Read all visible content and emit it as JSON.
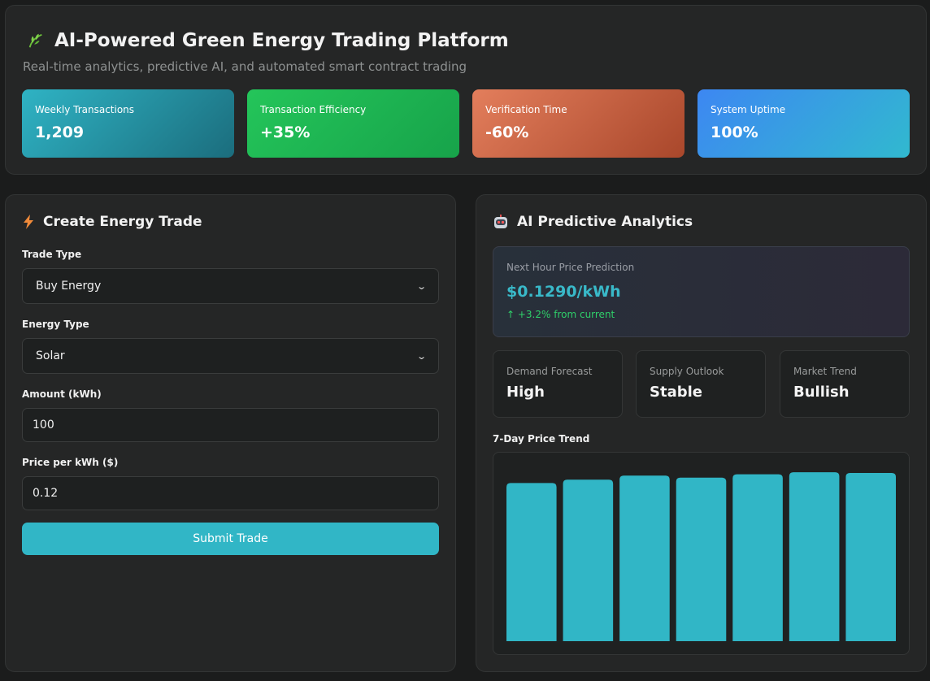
{
  "header": {
    "icon": "leaf-icon",
    "title": "AI-Powered Green Energy Trading Platform",
    "subtitle": "Real-time analytics, predictive AI, and automated smart contract trading",
    "stats": [
      {
        "label": "Weekly Transactions",
        "value": "1,209"
      },
      {
        "label": "Transaction Efficiency",
        "value": "+35%"
      },
      {
        "label": "Verification Time",
        "value": "-60%"
      },
      {
        "label": "System Uptime",
        "value": "100%"
      }
    ]
  },
  "trade_form": {
    "icon": "lightning-icon",
    "title": "Create Energy Trade",
    "trade_type_label": "Trade Type",
    "trade_type_value": "Buy Energy",
    "energy_type_label": "Energy Type",
    "energy_type_value": "Solar",
    "amount_label": "Amount (kWh)",
    "amount_value": "100",
    "price_label": "Price per kWh ($)",
    "price_value": "0.12",
    "submit_label": "Submit Trade"
  },
  "analytics": {
    "icon": "robot-icon",
    "title": "AI Predictive Analytics",
    "prediction": {
      "label": "Next Hour Price Prediction",
      "value": "$0.1290/kWh",
      "change": "↑ +3.2% from current"
    },
    "cards": [
      {
        "label": "Demand Forecast",
        "value": "High"
      },
      {
        "label": "Supply Outlook",
        "value": "Stable"
      },
      {
        "label": "Market Trend",
        "value": "Bullish"
      }
    ],
    "chart_title": "7-Day Price Trend"
  },
  "colors": {
    "accent": "#31b6c6",
    "positive": "#2fcf6a"
  },
  "chart_data": {
    "type": "bar",
    "title": "7-Day Price Trend",
    "categories": [
      "",
      "",
      "",
      "",
      "",
      "",
      ""
    ],
    "values": [
      0.1175,
      0.12,
      0.123,
      0.1215,
      0.124,
      0.1255,
      0.125
    ],
    "ylim": [
      0,
      0.125
    ],
    "grid": false,
    "legend": "none",
    "color": "#31b6c6"
  }
}
